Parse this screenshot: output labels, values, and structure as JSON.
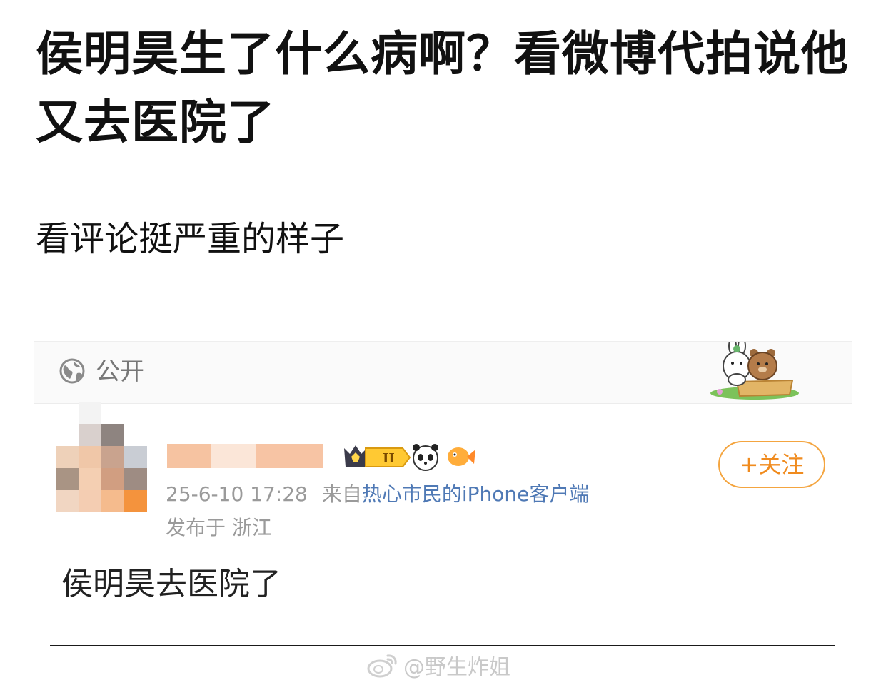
{
  "post": {
    "title": "侯明昊生了什么病啊？看微博代拍说他又去医院了",
    "body": "看评论挺严重的样子"
  },
  "embedded_weibo": {
    "visibility": "公开",
    "visibility_icon": "globe-icon",
    "sticker_icon": "rabbit-bear-sticker-icon",
    "author_badges": [
      "crown-level-II-badge-icon",
      "panda-badge-icon",
      "fish-badge-icon"
    ],
    "follow_label": "+关注",
    "timestamp": "25-6-10 17:28",
    "source_prefix": "来自",
    "source_name": "热心市民的iPhone客户端",
    "location": "发布于 浙江",
    "content": "侯明昊去医院了"
  },
  "watermark": {
    "text": "@野生炸姐",
    "icon": "weibo-logo-icon"
  },
  "colors": {
    "follow_accent": "#f08b1e",
    "source_link": "#4f79b5",
    "meta_gray": "#9a9a9a"
  }
}
